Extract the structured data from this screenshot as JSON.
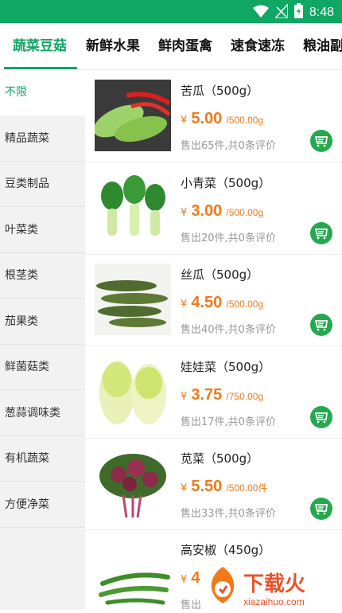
{
  "status_bar": {
    "time": "8:48",
    "icons": [
      "wifi-icon",
      "signal-icon",
      "battery-icon"
    ]
  },
  "tabs": [
    {
      "label": "蔬菜豆菇",
      "active": true
    },
    {
      "label": "新鲜水果",
      "active": false
    },
    {
      "label": "鲜肉蛋禽",
      "active": false
    },
    {
      "label": "速食速冻",
      "active": false
    },
    {
      "label": "粮油副",
      "active": false
    }
  ],
  "sidebar": {
    "items": [
      {
        "label": "不限",
        "active": true
      },
      {
        "label": "精品蔬菜"
      },
      {
        "label": "豆类制品"
      },
      {
        "label": "叶菜类"
      },
      {
        "label": "根茎类"
      },
      {
        "label": "茄果类"
      },
      {
        "label": "鲜菌菇类"
      },
      {
        "label": "葱蒜调味类"
      },
      {
        "label": "有机蔬菜"
      },
      {
        "label": "方便净菜"
      }
    ]
  },
  "products": [
    {
      "name": "苦瓜（500g）",
      "yen": "¥",
      "price": "5.00",
      "unit": "/500.00g",
      "sales": "售出65件,共0条评价",
      "image": "bitter-melon"
    },
    {
      "name": "小青菜（500g）",
      "yen": "¥",
      "price": "3.00",
      "unit": "/500.00g",
      "sales": "售出20件,共0条评价",
      "image": "bok-choy"
    },
    {
      "name": "丝瓜（500g）",
      "yen": "¥",
      "price": "4.50",
      "unit": "/500.00g",
      "sales": "售出40件,共0条评价",
      "image": "loofah"
    },
    {
      "name": "娃娃菜（500g）",
      "yen": "¥",
      "price": "3.75",
      "unit": "/750.00g",
      "sales": "售出17件,共0条评价",
      "image": "baby-cabbage"
    },
    {
      "name": "苋菜（500g）",
      "yen": "¥",
      "price": "5.50",
      "unit": "/500.00件",
      "sales": "售出33件,共0条评价",
      "image": "amaranth"
    },
    {
      "name": "高安椒（450g）",
      "yen": "¥",
      "price": "4",
      "unit": "",
      "sales": "售出",
      "image": "green-pepper"
    }
  ],
  "watermark": {
    "text": "下载火",
    "sub": "xiazaihuo.com"
  },
  "colors": {
    "brand": "#0fa763",
    "price": "#f07a1a",
    "cart": "#26a84f"
  }
}
